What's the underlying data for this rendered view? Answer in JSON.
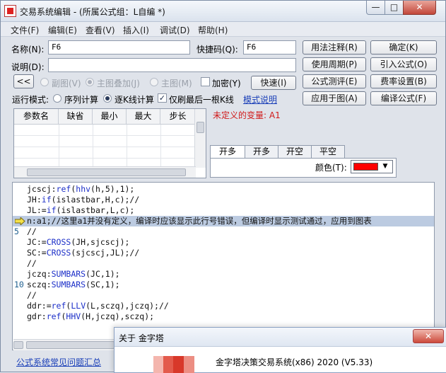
{
  "window": {
    "title": "交易系统编辑 - (所属公式组：L自编 *)",
    "min_label": "—",
    "max_label": "□",
    "close_label": "✕"
  },
  "menu": [
    "文件(F)",
    "编辑(E)",
    "查看(V)",
    "插入(I)",
    "调试(D)",
    "帮助(H)"
  ],
  "form": {
    "name_label": "名称(N):",
    "name_value": "F6",
    "code_label": "快捷码(Q):",
    "code_value": "F6",
    "desc_label": "说明(D):",
    "desc_value": ""
  },
  "buttons": {
    "usage": "用法注释(R)",
    "ok": "确定(K)",
    "period": "使用周期(P)",
    "import": "引入公式(O)",
    "test": "公式测评(E)",
    "fee": "费率设置(B)",
    "quick": "快速(I)",
    "apply": "应用于图(A)",
    "compile": "编译公式(F)",
    "collapse": "<<"
  },
  "options": {
    "sub_chart": "副图(V)",
    "main_overlay": "主图叠加(J)",
    "main_chart": "主图(M)",
    "encrypt": "加密(Y)"
  },
  "run_mode": {
    "label": "运行模式:",
    "sequential": "序列计算",
    "tick": "逐K线计算",
    "last_bar": "仅刷最后一根K线",
    "mode_help": "模式说明"
  },
  "error_text": "未定义的变量: A1",
  "params_table": {
    "headers": [
      "参数名",
      "缺省",
      "最小",
      "最大",
      "步长"
    ]
  },
  "signal_tabs": [
    "开多",
    "开多",
    "开空",
    "平空"
  ],
  "color_label": "颜色(T):",
  "color_value": "#ff0000",
  "code_lines": [
    {
      "num": "",
      "text": "jcscj:ref(hhv(h,5),1);"
    },
    {
      "num": "",
      "text": "JH:if(islastbar,H,c);//"
    },
    {
      "num": "",
      "text": "JL:=if(islastbar,L,c);"
    },
    {
      "num": "",
      "text": "n:a1;//这里a1并没有定义，编译时应该显示此行号错误，但编译时显示测试通过，应用到图表"
    },
    {
      "num": "5",
      "text": "//"
    },
    {
      "num": "",
      "text": "JC:=CROSS(JH,sjcscj);"
    },
    {
      "num": "",
      "text": "SC:=CROSS(sjcscj,JL);//"
    },
    {
      "num": "",
      "text": "//"
    },
    {
      "num": "",
      "text": "jczq:SUMBARS(JC,1);"
    },
    {
      "num": "10",
      "text": "sczq:SUMBARS(SC,1);"
    },
    {
      "num": "",
      "text": "//"
    },
    {
      "num": "",
      "text": "ddr:=ref(LLV(L,sczq),jczq);//"
    },
    {
      "num": "",
      "text": "gdr:ref(HHV(H,jczq),sczq);"
    }
  ],
  "faq_link": "公式系统常见问题汇总",
  "about": {
    "title": "关于 金字塔",
    "close_label": "✕",
    "product_line": "金字塔决策交易系统(x86) 2020 (V5.33)"
  }
}
